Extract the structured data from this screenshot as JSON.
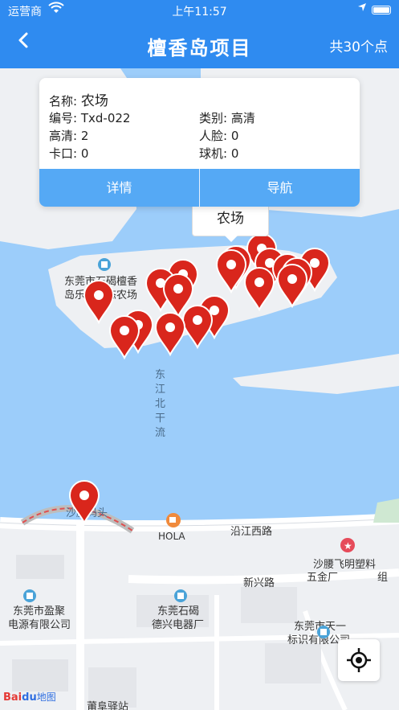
{
  "status": {
    "carrier": "运营商",
    "time": "上午11:57"
  },
  "header": {
    "back_icon": "chevron-left-icon",
    "title": "檀香岛项目",
    "count": "共30个点",
    "bg": "#2f8bf0"
  },
  "card": {
    "name_label": "名称:",
    "name_value": "农场",
    "code_label": "编号:",
    "code_value": "Txd-022",
    "type_label": "类别:",
    "type_value": "高清",
    "hd_label": "高清:",
    "hd_value": "2",
    "face_label": "人脸:",
    "face_value": "0",
    "gate_label": "卡口:",
    "gate_value": "0",
    "dome_label": "球机:",
    "dome_value": "0",
    "detail_btn": "详情",
    "nav_btn": "导航"
  },
  "callout": "农场",
  "map": {
    "labels": {
      "park_1": "东莞市石碣檀香",
      "park_2": "岛乐活生态农场",
      "river_1": "东",
      "river_2": "江",
      "river_3": "北",
      "river_4": "干",
      "river_5": "流",
      "pier": "沙腰码头",
      "hola": "HOLA",
      "road_1": "沿江西路",
      "road_2": "新兴路",
      "factory_1a": "沙腰飞明塑料",
      "factory_1b": "五金厂",
      "factory_1c": "组",
      "company_1a": "东莞市盈聚",
      "company_1b": "电源有限公司",
      "company_2a": "东莞石碣",
      "company_2b": "德兴电器厂",
      "company_3a": "东莞市天一",
      "company_3b": "标识有限公司",
      "bus": "莆阜驿站"
    },
    "logo": {
      "a": "Bai",
      "b": "du",
      "c": "地图"
    },
    "colors": {
      "water": "#9ccdfa",
      "land": "#f3f4f6",
      "marker": "#d9261c"
    }
  }
}
